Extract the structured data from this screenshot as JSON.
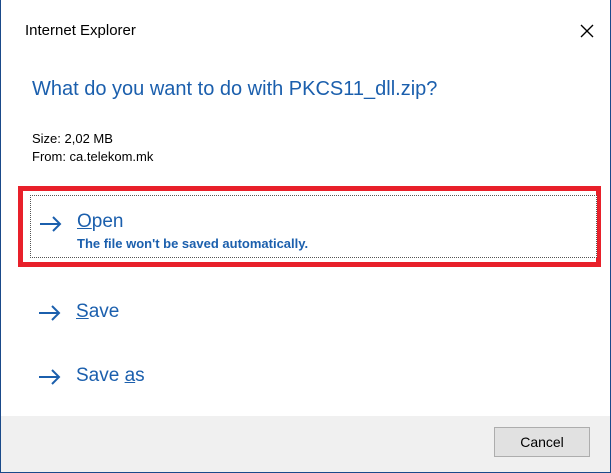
{
  "window": {
    "title": "Internet Explorer",
    "close_icon": "close-icon"
  },
  "prompt": {
    "question": "What do you want to do with PKCS11_dll.zip?",
    "size_text": "Size: 2,02 MB",
    "from_text": "From: ca.telekom.mk"
  },
  "options": [
    {
      "icon": "arrow-right-icon",
      "label_pre": "",
      "label_accel": "O",
      "label_post": "pen",
      "description": "The file won't be saved automatically.",
      "highlighted": true
    },
    {
      "icon": "arrow-right-icon",
      "label_pre": "",
      "label_accel": "S",
      "label_post": "ave"
    },
    {
      "icon": "arrow-right-icon",
      "label_pre": "Save ",
      "label_accel": "a",
      "label_post": "s"
    }
  ],
  "footer": {
    "cancel_label": "Cancel"
  },
  "colors": {
    "accent_blue": "#1b5fad",
    "highlight_red": "#e8202a",
    "footer_bg": "#f0f0f0",
    "window_border": "#1a4a8a"
  }
}
